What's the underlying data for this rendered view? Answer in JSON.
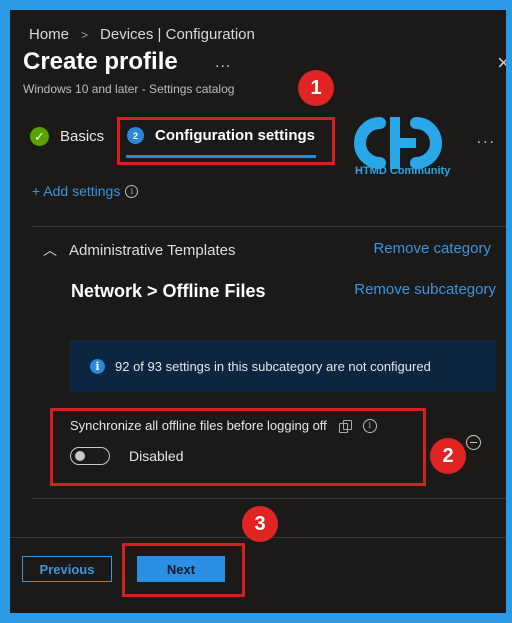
{
  "breadcrumb": {
    "home": "Home",
    "separator": ">",
    "current": "Devices | Configuration"
  },
  "header": {
    "title": "Create profile",
    "more": "...",
    "subtitle": "Windows 10 and later - Settings catalog",
    "close": "×"
  },
  "tabs": {
    "basics": {
      "label": "Basics",
      "icon": "checkmark-icon",
      "status": "complete"
    },
    "configuration": {
      "label": "Configuration settings",
      "step": "2",
      "active": true
    },
    "more": "..."
  },
  "logo": {
    "text": "HTMD Community",
    "color": "#2aa7e8"
  },
  "add_settings": {
    "label": "+ Add settings",
    "info_icon": "info-icon"
  },
  "category": {
    "name": "Administrative Templates",
    "remove_label": "Remove category",
    "subcategory": "Network > Offline Files",
    "remove_sub_label": "Remove subcategory"
  },
  "banner": {
    "icon": "info-icon",
    "text": "92 of 93 settings in this subcategory are not configured"
  },
  "setting": {
    "label": "Synchronize all offline files before logging off",
    "toggle_state": "Disabled",
    "toggle_on": false
  },
  "footer": {
    "previous_label": "Previous",
    "next_label": "Next"
  },
  "callouts": [
    "1",
    "2",
    "3"
  ],
  "colors": {
    "accent": "#2b88d8",
    "link": "#3a96dd",
    "highlight_box": "#d42020",
    "badge": "#e02424",
    "success": "#57a300",
    "outer_border": "#2a9ae6"
  }
}
